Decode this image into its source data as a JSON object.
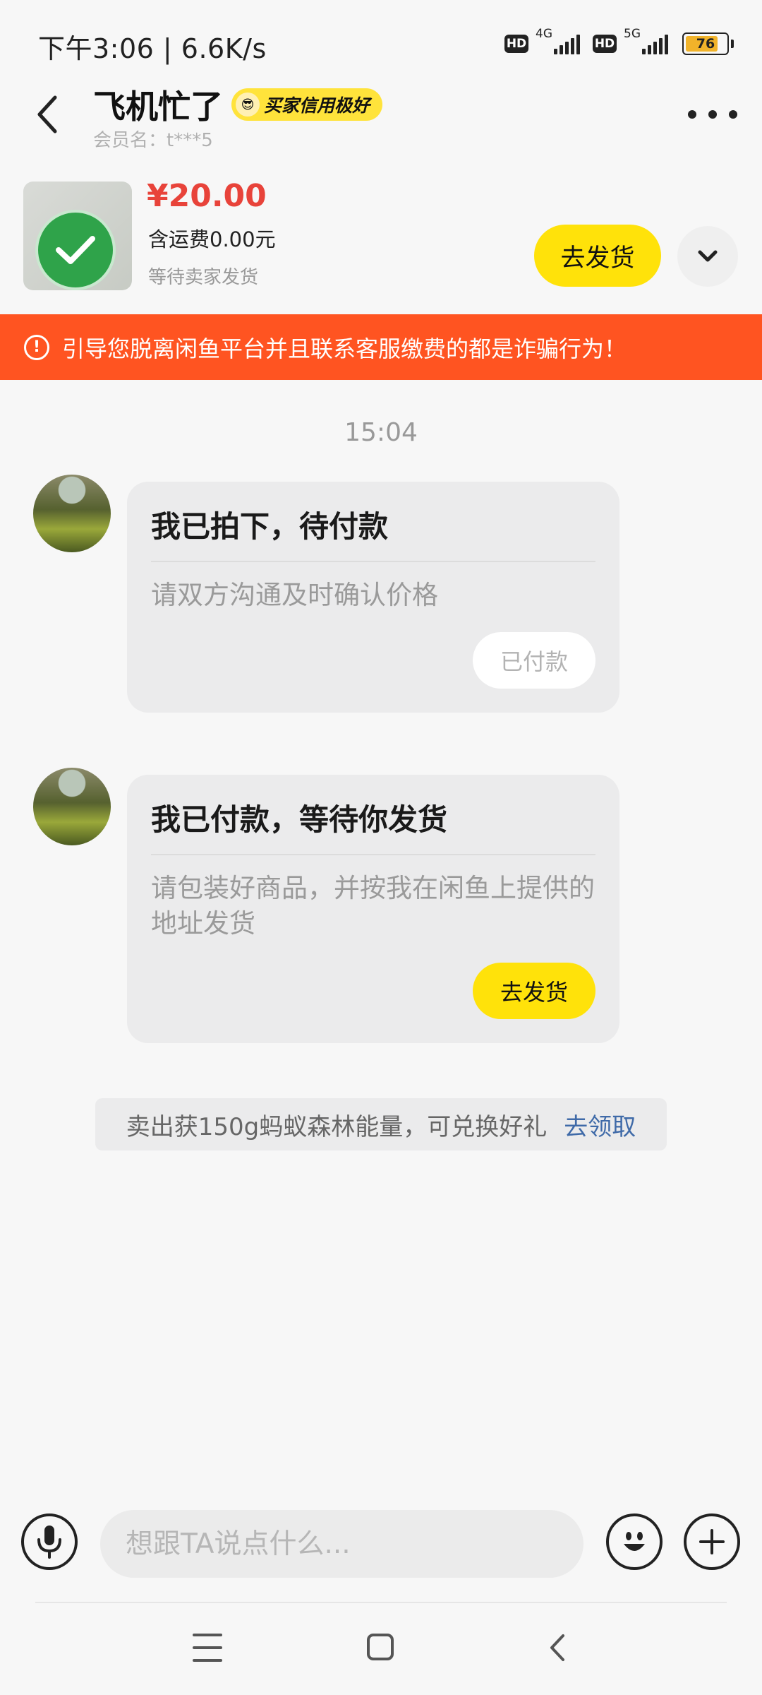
{
  "status_bar": {
    "time": "下午3:06 | 6.6K/s",
    "hd1": "HD",
    "net1": "4G",
    "hd2": "HD",
    "net2": "5G",
    "battery": "76"
  },
  "header": {
    "name": "飞机忙了",
    "badge": "买家信用极好",
    "member": "会员名：t***5"
  },
  "product": {
    "price": "¥20.00",
    "shipping": "含运费0.00元",
    "status": "等待卖家发货",
    "ship_button": "去发货"
  },
  "warning": {
    "icon": "!",
    "text": "引导您脱离闲鱼平台并且联系客服缴费的都是诈骗行为！"
  },
  "chat": {
    "timestamp": "15:04",
    "messages": [
      {
        "title": "我已拍下，待付款",
        "desc": "请双方沟通及时确认价格",
        "button": "已付款"
      },
      {
        "title": "我已付款，等待你发货",
        "desc": "请包装好商品，并按我在闲鱼上提供的地址发货",
        "button": "去发货"
      }
    ],
    "reward_text": "卖出获150g蚂蚁森林能量，可兑换好礼",
    "reward_link": "去领取"
  },
  "input": {
    "placeholder": "想跟TA说点什么..."
  },
  "colors": {
    "accent_yellow": "#ffe20a",
    "warning_orange": "#ff5421",
    "price_red": "#e8433a",
    "link_blue": "#3f6aa8"
  },
  "icons": {
    "back": "chevron-left-icon",
    "more": "more-dots-icon",
    "expand": "chevron-down-icon",
    "voice": "microphone-icon",
    "emoji": "smiley-icon",
    "plus": "plus-icon"
  }
}
